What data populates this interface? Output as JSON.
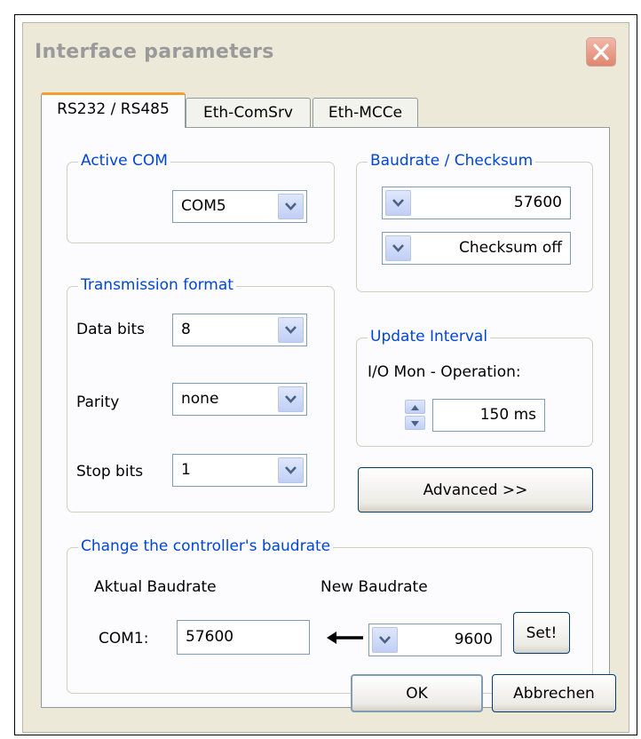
{
  "window": {
    "title": "Interface parameters"
  },
  "tabs": [
    {
      "label": "RS232 / RS485",
      "active": true
    },
    {
      "label": "Eth-ComSrv",
      "active": false
    },
    {
      "label": "Eth-MCCe",
      "active": false
    }
  ],
  "active_com": {
    "legend": "Active COM",
    "value": "COM5"
  },
  "baudrate_checksum": {
    "legend": "Baudrate / Checksum",
    "baudrate": "57600",
    "checksum": "Checksum off"
  },
  "transmission_format": {
    "legend": "Transmission format",
    "data_bits_label": "Data bits",
    "data_bits_value": "8",
    "parity_label": "Parity",
    "parity_value": "none",
    "stop_bits_label": "Stop bits",
    "stop_bits_value": "1"
  },
  "update_interval": {
    "legend": "Update Interval",
    "label": "I/O Mon - Operation:",
    "value": "150 ms"
  },
  "advanced_button": "Advanced >>",
  "change_baudrate": {
    "legend": "Change the controller's baudrate",
    "actual_label": "Aktual Baudrate",
    "new_label": "New Baudrate",
    "com_label": "COM1:",
    "actual_value": "57600",
    "new_value": "9600",
    "set_button": "Set!"
  },
  "footer": {
    "ok_label": "OK",
    "cancel_label": "Abbrechen"
  },
  "colors": {
    "group_label": "#0046d5",
    "dialog_bg": "#ece9d8",
    "tab_accent": "#f0a030"
  },
  "icons": [
    "close-icon",
    "dropdown-arrow-icon",
    "spin-up-icon",
    "spin-down-icon",
    "left-arrow-icon"
  ]
}
